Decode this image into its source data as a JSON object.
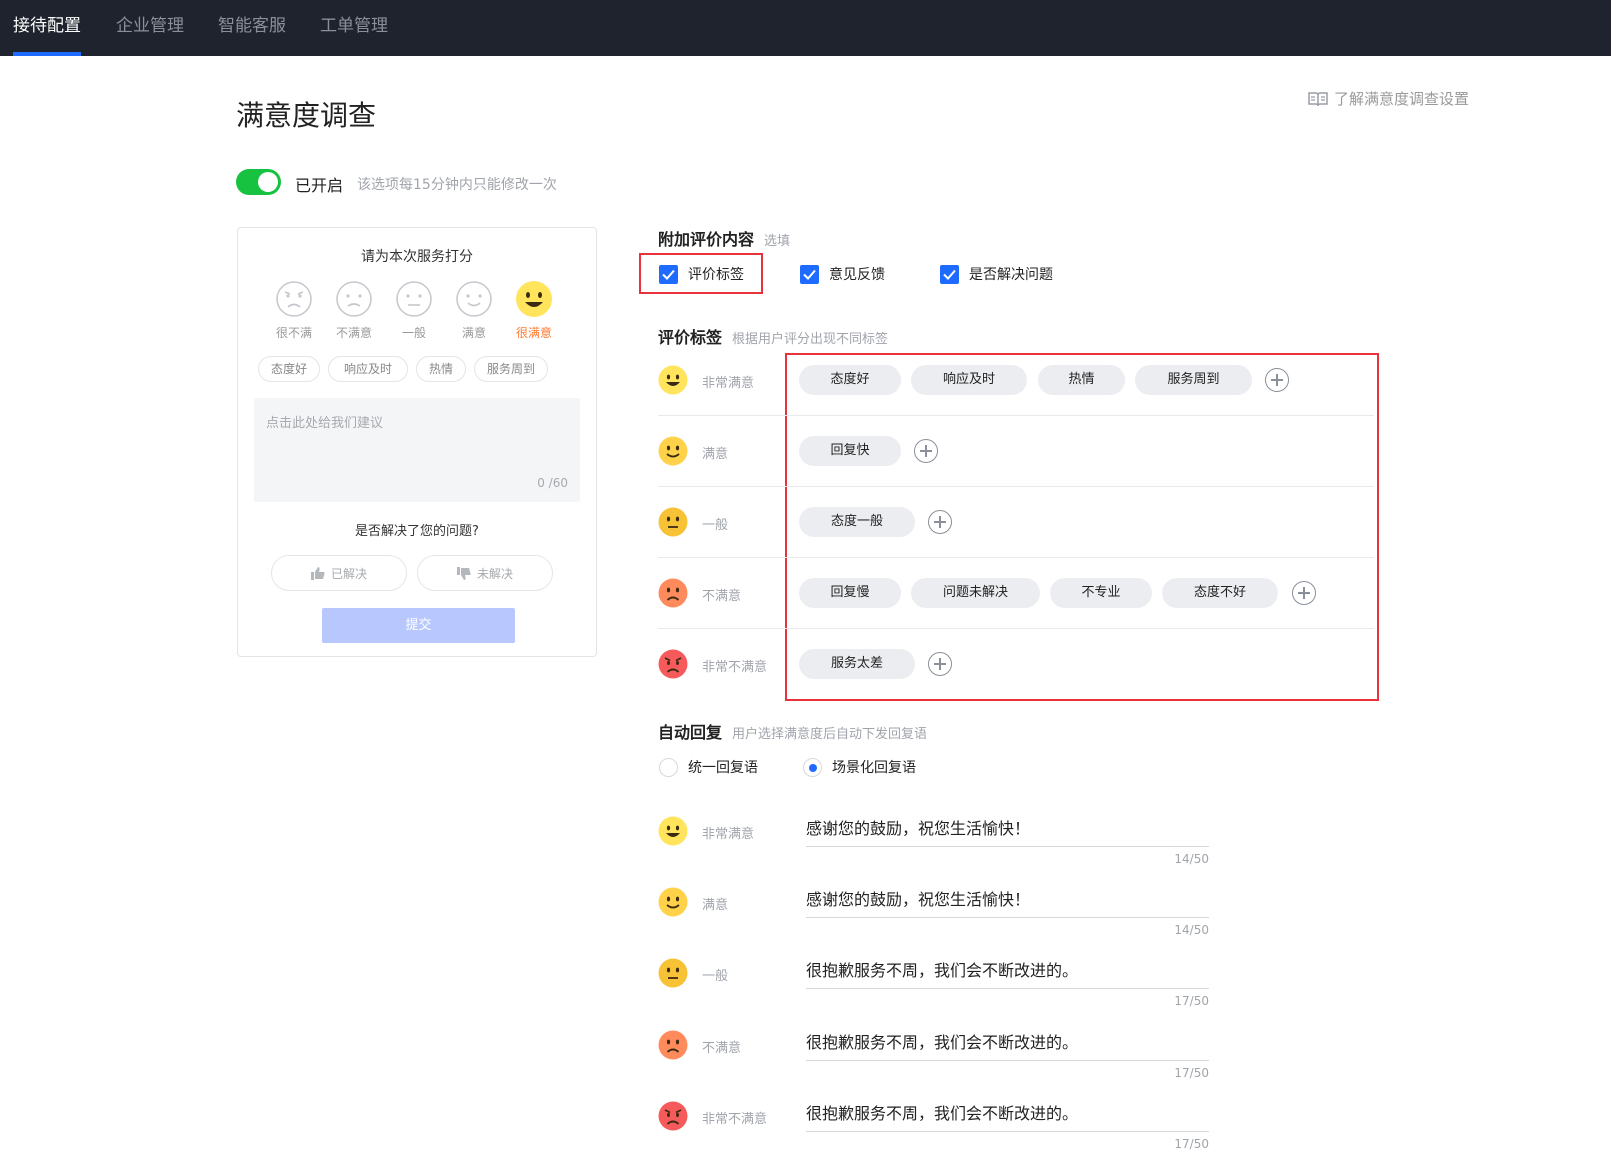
{
  "nav": {
    "tabs": [
      {
        "label": "接待配置",
        "active": true
      },
      {
        "label": "企业管理",
        "active": false
      },
      {
        "label": "智能客服",
        "active": false
      },
      {
        "label": "工单管理",
        "active": false
      }
    ]
  },
  "page": {
    "title": "满意度调查",
    "help_link": "了解满意度调查设置"
  },
  "toggle": {
    "on": true,
    "label": "已开启",
    "hint": "该选项每15分钟内只能修改一次"
  },
  "preview": {
    "title": "请为本次服务打分",
    "faces": [
      {
        "label": "很不满",
        "selected": false
      },
      {
        "label": "不满意",
        "selected": false
      },
      {
        "label": "一般",
        "selected": false
      },
      {
        "label": "满意",
        "selected": false
      },
      {
        "label": "很满意",
        "selected": true
      }
    ],
    "tags": [
      "态度好",
      "响应及时",
      "热情",
      "服务周到"
    ],
    "suggestion_placeholder": "点击此处给我们建议",
    "char_count": "0 /60",
    "question": "是否解决了您的问题?",
    "resolved_label": "已解决",
    "unresolved_label": "未解决",
    "submit_label": "提交"
  },
  "additional": {
    "title": "附加评价内容",
    "hint": "选填",
    "options": [
      {
        "label": "评价标签",
        "checked": true
      },
      {
        "label": "意见反馈",
        "checked": true
      },
      {
        "label": "是否解决问题",
        "checked": true
      }
    ]
  },
  "rating_tags": {
    "title": "评价标签",
    "hint": "根据用户评分出现不同标签",
    "rows": [
      {
        "level": "非常满意",
        "tags": [
          "态度好",
          "响应及时",
          "热情",
          "服务周到"
        ]
      },
      {
        "level": "满意",
        "tags": [
          "回复快"
        ]
      },
      {
        "level": "一般",
        "tags": [
          "态度一般"
        ]
      },
      {
        "level": "不满意",
        "tags": [
          "回复慢",
          "问题未解决",
          "不专业",
          "态度不好"
        ]
      },
      {
        "level": "非常不满意",
        "tags": [
          "服务太差"
        ]
      }
    ]
  },
  "auto_reply": {
    "title": "自动回复",
    "hint": "用户选择满意度后自动下发回复语",
    "modes": [
      {
        "label": "统一回复语",
        "selected": false
      },
      {
        "label": "场景化回复语",
        "selected": true
      }
    ],
    "rows": [
      {
        "level": "非常满意",
        "text": "感谢您的鼓励，祝您生活愉快！",
        "count": "14/50"
      },
      {
        "level": "满意",
        "text": "感谢您的鼓励，祝您生活愉快！",
        "count": "14/50"
      },
      {
        "level": "一般",
        "text": "很抱歉服务不周，我们会不断改进的。",
        "count": "17/50"
      },
      {
        "level": "不满意",
        "text": "很抱歉服务不周，我们会不断改进的。",
        "count": "17/50"
      },
      {
        "level": "非常不满意",
        "text": "很抱歉服务不周，我们会不断改进的。",
        "count": "17/50"
      }
    ]
  },
  "colors": {
    "accent": "#1f6bff",
    "toggle_on": "#16c23f",
    "highlight_box": "#e8323c",
    "face_very_satisfied": "#ffe45c",
    "face_satisfied": "#ffd24a",
    "face_neutral": "#f7c236",
    "face_dissatisfied": "#ff8a5c",
    "face_very_dissatisfied": "#f65a5a"
  }
}
